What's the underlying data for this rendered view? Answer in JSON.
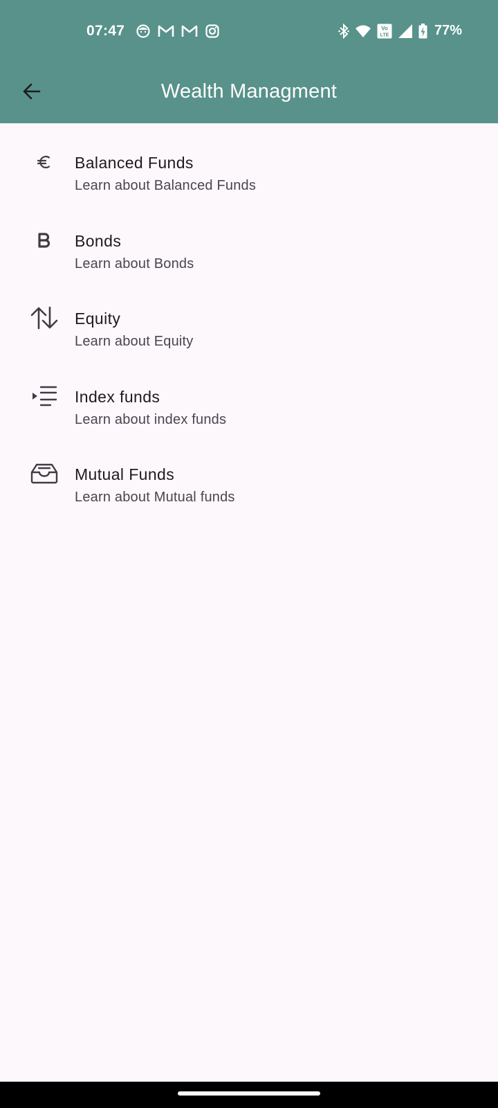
{
  "status_bar": {
    "time": "07:47",
    "left_icons": [
      "face-icon",
      "gmail-icon",
      "gmail-icon",
      "instagram-icon"
    ],
    "right_icons": [
      "bluetooth-icon",
      "wifi-icon",
      "volte-icon",
      "signal-icon",
      "battery-charging-icon"
    ],
    "battery": "77%"
  },
  "app_bar": {
    "title": "Wealth Managment",
    "back_icon": "arrow-back-icon",
    "background_color": "#58928a"
  },
  "items": [
    {
      "title": "Balanced Funds",
      "subtitle": "Learn about Balanced Funds",
      "icon": "euro-icon"
    },
    {
      "title": "Bonds",
      "subtitle": "Learn about Bonds",
      "icon": "bold-b-icon"
    },
    {
      "title": "Equity",
      "subtitle": "Learn about Equity",
      "icon": "swap-vertical-icon"
    },
    {
      "title": "Index funds",
      "subtitle": "Learn about index funds",
      "icon": "list-indent-icon"
    },
    {
      "title": "Mutual Funds",
      "subtitle": "Learn about Mutual funds",
      "icon": "inbox-tray-icon"
    }
  ]
}
